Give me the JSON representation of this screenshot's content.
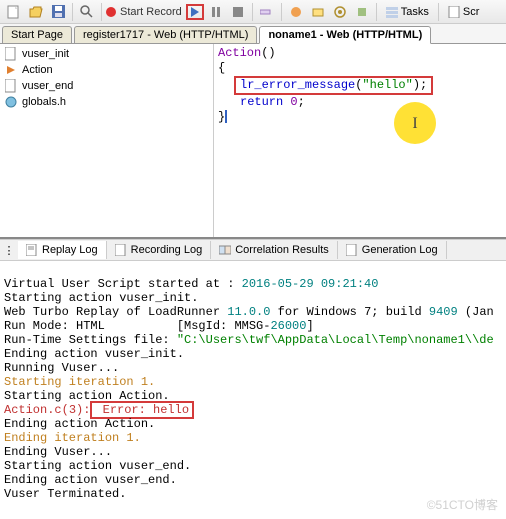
{
  "toolbar": {
    "start_rec_label": "Start Record",
    "tasks_label": "Tasks",
    "scr_label": "Scr"
  },
  "file_tabs": {
    "start_page": "Start Page",
    "register": "register1717 - Web (HTTP/HTML)",
    "noname": "noname1 - Web (HTTP/HTML)"
  },
  "sidebar": {
    "items": [
      {
        "label": "vuser_init"
      },
      {
        "label": "Action"
      },
      {
        "label": "vuser_end"
      },
      {
        "label": "globals.h"
      }
    ]
  },
  "code": {
    "l1a": "Action",
    "l1b": "()",
    "l2": "{",
    "l3a": "lr_error_message",
    "l3b": "(",
    "l3c": "\"hello\"",
    "l3d": ");",
    "l4a": "return",
    "l4b": " ",
    "l4c": "0",
    "l4d": ";",
    "l5": "}"
  },
  "log_tabs": {
    "replay": "Replay Log",
    "recording": "Recording Log",
    "correlation": "Correlation Results",
    "generation": "Generation Log"
  },
  "log": {
    "l1a": "Virtual User Script started at : ",
    "l1b": "2016-05-29 09:21:40",
    "l2": "Starting action vuser_init.",
    "l3a": "Web Turbo Replay of LoadRunner ",
    "l3b": "11.0.0",
    "l3c": " for Windows 7; build ",
    "l3d": "9409",
    "l3e": " (Jan",
    "l4a": "Run Mode: HTML  \t[MsgId: MMSG-",
    "l4b": "26000",
    "l4c": "]",
    "l5a": "Run-Time Settings file: ",
    "l5b": "\"C:\\Users\\twf\\AppData\\Local\\Temp\\noname1\\\\de",
    "l6": "Ending action vuser_init.",
    "l7": "Running Vuser...",
    "l8": "Starting iteration 1.",
    "l9": "Starting action Action.",
    "l10a": "Action.c(",
    "l10b": "3",
    "l10c": "):",
    "l10d": " Error: hello",
    "l11": "Ending action Action.",
    "l12": "Ending iteration 1.",
    "l13": "Ending Vuser...",
    "l14": "Starting action vuser_end.",
    "l15": "Ending action vuser_end.",
    "l16": "Vuser Terminated."
  },
  "watermark": "©51CTO博客"
}
